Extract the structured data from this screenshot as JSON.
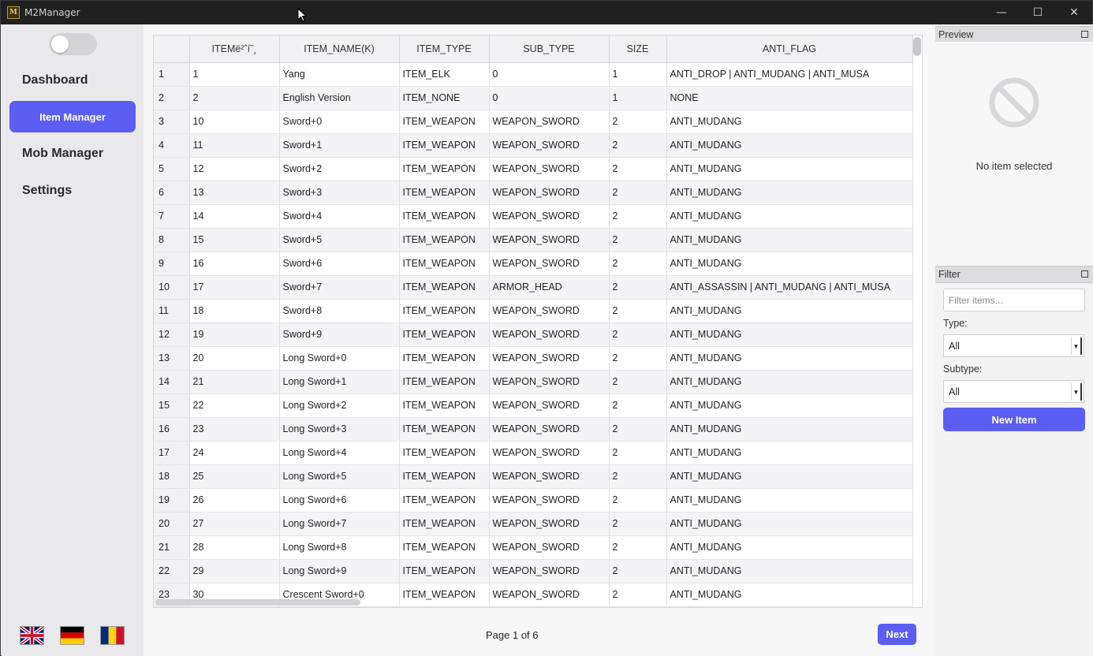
{
  "window": {
    "title": "M2Manager",
    "icon_glyph": "M",
    "controls": {
      "minimize": "—",
      "maximize": "☐",
      "close": "✕"
    }
  },
  "sidebar": {
    "toggle_on": false,
    "nav": [
      {
        "label": "Dashboard",
        "active": false
      },
      {
        "label": "Item Manager",
        "active": true
      },
      {
        "label": "Mob Manager",
        "active": false
      },
      {
        "label": "Settings",
        "active": false
      }
    ],
    "flags": [
      "uk-flag-icon",
      "germany-flag-icon",
      "romania-flag-icon"
    ]
  },
  "table": {
    "columns": [
      "",
      "ITEMë²ˆí˜¸",
      "ITEM_NAME(K)",
      "ITEM_TYPE",
      "SUB_TYPE",
      "SIZE",
      "ANTI_FLAG"
    ],
    "rows": [
      [
        "1",
        "1",
        "Yang",
        "ITEM_ELK",
        "0",
        "1",
        "ANTI_DROP | ANTI_MUDANG | ANTI_MUSA"
      ],
      [
        "2",
        "2",
        "English Version",
        "ITEM_NONE",
        "0",
        "1",
        "NONE"
      ],
      [
        "3",
        "10",
        "Sword+0",
        "ITEM_WEAPON",
        "WEAPON_SWORD",
        "2",
        "ANTI_MUDANG"
      ],
      [
        "4",
        "11",
        "Sword+1",
        "ITEM_WEAPON",
        "WEAPON_SWORD",
        "2",
        "ANTI_MUDANG"
      ],
      [
        "5",
        "12",
        "Sword+2",
        "ITEM_WEAPON",
        "WEAPON_SWORD",
        "2",
        "ANTI_MUDANG"
      ],
      [
        "6",
        "13",
        "Sword+3",
        "ITEM_WEAPON",
        "WEAPON_SWORD",
        "2",
        "ANTI_MUDANG"
      ],
      [
        "7",
        "14",
        "Sword+4",
        "ITEM_WEAPON",
        "WEAPON_SWORD",
        "2",
        "ANTI_MUDANG"
      ],
      [
        "8",
        "15",
        "Sword+5",
        "ITEM_WEAPON",
        "WEAPON_SWORD",
        "2",
        "ANTI_MUDANG"
      ],
      [
        "9",
        "16",
        "Sword+6",
        "ITEM_WEAPON",
        "WEAPON_SWORD",
        "2",
        "ANTI_MUDANG"
      ],
      [
        "10",
        "17",
        "Sword+7",
        "ITEM_WEAPON",
        "ARMOR_HEAD",
        "2",
        "ANTI_ASSASSIN | ANTI_MUDANG | ANTI_MUSA"
      ],
      [
        "11",
        "18",
        "Sword+8",
        "ITEM_WEAPON",
        "WEAPON_SWORD",
        "2",
        "ANTI_MUDANG"
      ],
      [
        "12",
        "19",
        "Sword+9",
        "ITEM_WEAPON",
        "WEAPON_SWORD",
        "2",
        "ANTI_MUDANG"
      ],
      [
        "13",
        "20",
        "Long Sword+0",
        "ITEM_WEAPON",
        "WEAPON_SWORD",
        "2",
        "ANTI_MUDANG"
      ],
      [
        "14",
        "21",
        "Long Sword+1",
        "ITEM_WEAPON",
        "WEAPON_SWORD",
        "2",
        "ANTI_MUDANG"
      ],
      [
        "15",
        "22",
        "Long Sword+2",
        "ITEM_WEAPON",
        "WEAPON_SWORD",
        "2",
        "ANTI_MUDANG"
      ],
      [
        "16",
        "23",
        "Long Sword+3",
        "ITEM_WEAPON",
        "WEAPON_SWORD",
        "2",
        "ANTI_MUDANG"
      ],
      [
        "17",
        "24",
        "Long Sword+4",
        "ITEM_WEAPON",
        "WEAPON_SWORD",
        "2",
        "ANTI_MUDANG"
      ],
      [
        "18",
        "25",
        "Long Sword+5",
        "ITEM_WEAPON",
        "WEAPON_SWORD",
        "2",
        "ANTI_MUDANG"
      ],
      [
        "19",
        "26",
        "Long Sword+6",
        "ITEM_WEAPON",
        "WEAPON_SWORD",
        "2",
        "ANTI_MUDANG"
      ],
      [
        "20",
        "27",
        "Long Sword+7",
        "ITEM_WEAPON",
        "WEAPON_SWORD",
        "2",
        "ANTI_MUDANG"
      ],
      [
        "21",
        "28",
        "Long Sword+8",
        "ITEM_WEAPON",
        "WEAPON_SWORD",
        "2",
        "ANTI_MUDANG"
      ],
      [
        "22",
        "29",
        "Long Sword+9",
        "ITEM_WEAPON",
        "WEAPON_SWORD",
        "2",
        "ANTI_MUDANG"
      ],
      [
        "23",
        "30",
        "Crescent Sword+0",
        "ITEM_WEAPON",
        "WEAPON_SWORD",
        "2",
        "ANTI_MUDANG"
      ]
    ]
  },
  "pager": {
    "text": "Page 1 of 6",
    "next_label": "Next"
  },
  "preview": {
    "header": "Preview",
    "empty_text": "No item selected",
    "icon": "no-entry-icon"
  },
  "filter": {
    "header": "Filter",
    "search_placeholder": "Filter items...",
    "type_label": "Type:",
    "type_value": "All",
    "subtype_label": "Subtype:",
    "subtype_value": "All",
    "new_item_label": "New Item"
  },
  "colors": {
    "accent": "#5b5ef0",
    "titlebar": "#202020",
    "sidebar": "#e9e9ec"
  }
}
